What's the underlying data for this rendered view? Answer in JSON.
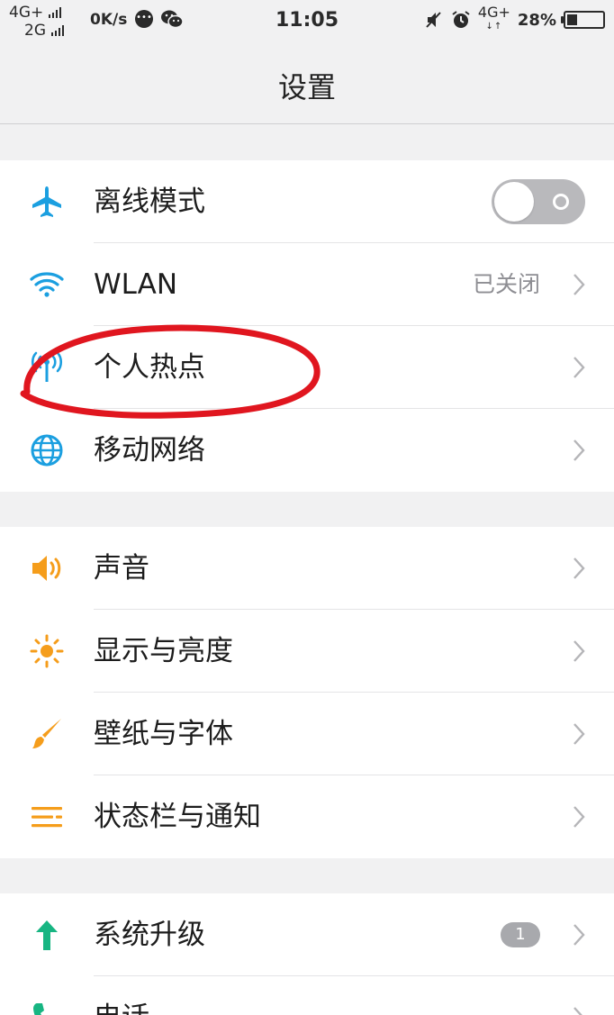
{
  "status_bar": {
    "signal_top": "4G+",
    "signal_bottom": "2G",
    "speed": "0K/s",
    "time": "11:05",
    "network_right": "4G+",
    "battery_percent_text": "28%",
    "battery_level": 0.28
  },
  "header": {
    "title": "设置"
  },
  "groups": [
    {
      "items": [
        {
          "label": "离线模式",
          "icon": "airplane-icon",
          "control": "toggle",
          "toggle_on": false
        },
        {
          "label": "WLAN",
          "icon": "wifi-icon",
          "value": "已关闭"
        },
        {
          "label": "个人热点",
          "icon": "hotspot-icon"
        },
        {
          "label": "移动网络",
          "icon": "globe-icon"
        }
      ]
    },
    {
      "items": [
        {
          "label": "声音",
          "icon": "speaker-icon"
        },
        {
          "label": "显示与亮度",
          "icon": "brightness-icon"
        },
        {
          "label": "壁纸与字体",
          "icon": "brush-icon"
        },
        {
          "label": "状态栏与通知",
          "icon": "menu-lines-icon"
        }
      ]
    },
    {
      "items": [
        {
          "label": "系统升级",
          "icon": "arrow-up-icon",
          "badge": "1"
        },
        {
          "label": "电话",
          "icon": "phone-icon"
        }
      ]
    }
  ],
  "colors": {
    "network_icons": "#1b9fe0",
    "media_icons": "#f59d1b",
    "upgrade_icon": "#17b582",
    "annotation": "#e0161f"
  }
}
